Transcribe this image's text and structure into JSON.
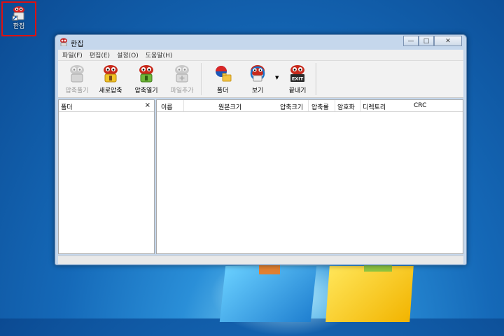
{
  "desktop": {
    "icon_label": "한집"
  },
  "window": {
    "title": "한집",
    "controls": {
      "minimize": "—",
      "maximize": "□",
      "close": "✕"
    }
  },
  "menu": [
    "파일(F)",
    "편집(E)",
    "설정(O)",
    "도움말(H)"
  ],
  "toolbar": {
    "items": [
      {
        "label": "압축풀기",
        "icon": "extract-icon",
        "enabled": false
      },
      {
        "label": "새로압축",
        "icon": "new-archive-icon",
        "enabled": true
      },
      {
        "label": "압축열기",
        "icon": "open-archive-icon",
        "enabled": true
      },
      {
        "label": "파일추가",
        "icon": "add-file-icon",
        "enabled": false
      },
      {
        "label": "폴더",
        "icon": "folder-icon",
        "enabled": true
      },
      {
        "label": "보기",
        "icon": "view-icon",
        "enabled": true
      },
      {
        "label": "끝내기",
        "icon": "exit-icon",
        "enabled": true
      }
    ],
    "exit_badge": "EXIT"
  },
  "left_pane": {
    "header": "폴더",
    "close": "×"
  },
  "file_list": {
    "columns": [
      "이름",
      "원본크기",
      "압축크기",
      "압축률",
      "암호화",
      "디렉토리",
      "CRC"
    ]
  }
}
